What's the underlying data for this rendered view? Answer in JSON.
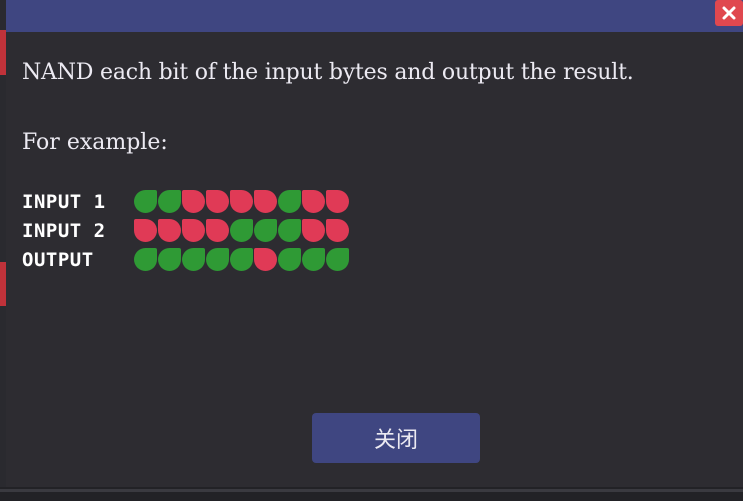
{
  "dialog": {
    "description": "NAND each bit of the input bytes and output the result.",
    "example_label": "For example:",
    "close_button_label": "关闭",
    "close_icon": "close-icon"
  },
  "example": {
    "rows": [
      {
        "label": "INPUT 1",
        "bits": [
          1,
          1,
          0,
          0,
          0,
          0,
          1,
          0,
          0
        ]
      },
      {
        "label": "INPUT 2",
        "bits": [
          0,
          0,
          0,
          0,
          1,
          1,
          1,
          0,
          0
        ]
      },
      {
        "label": "OUTPUT",
        "bits": [
          1,
          1,
          1,
          1,
          1,
          0,
          1,
          1,
          1
        ]
      }
    ]
  },
  "colors": {
    "on": "#2f9a35",
    "off": "#e03a56",
    "titlebar": "#3f4681",
    "panel": "#2d2c31",
    "close": "#e0484f"
  }
}
